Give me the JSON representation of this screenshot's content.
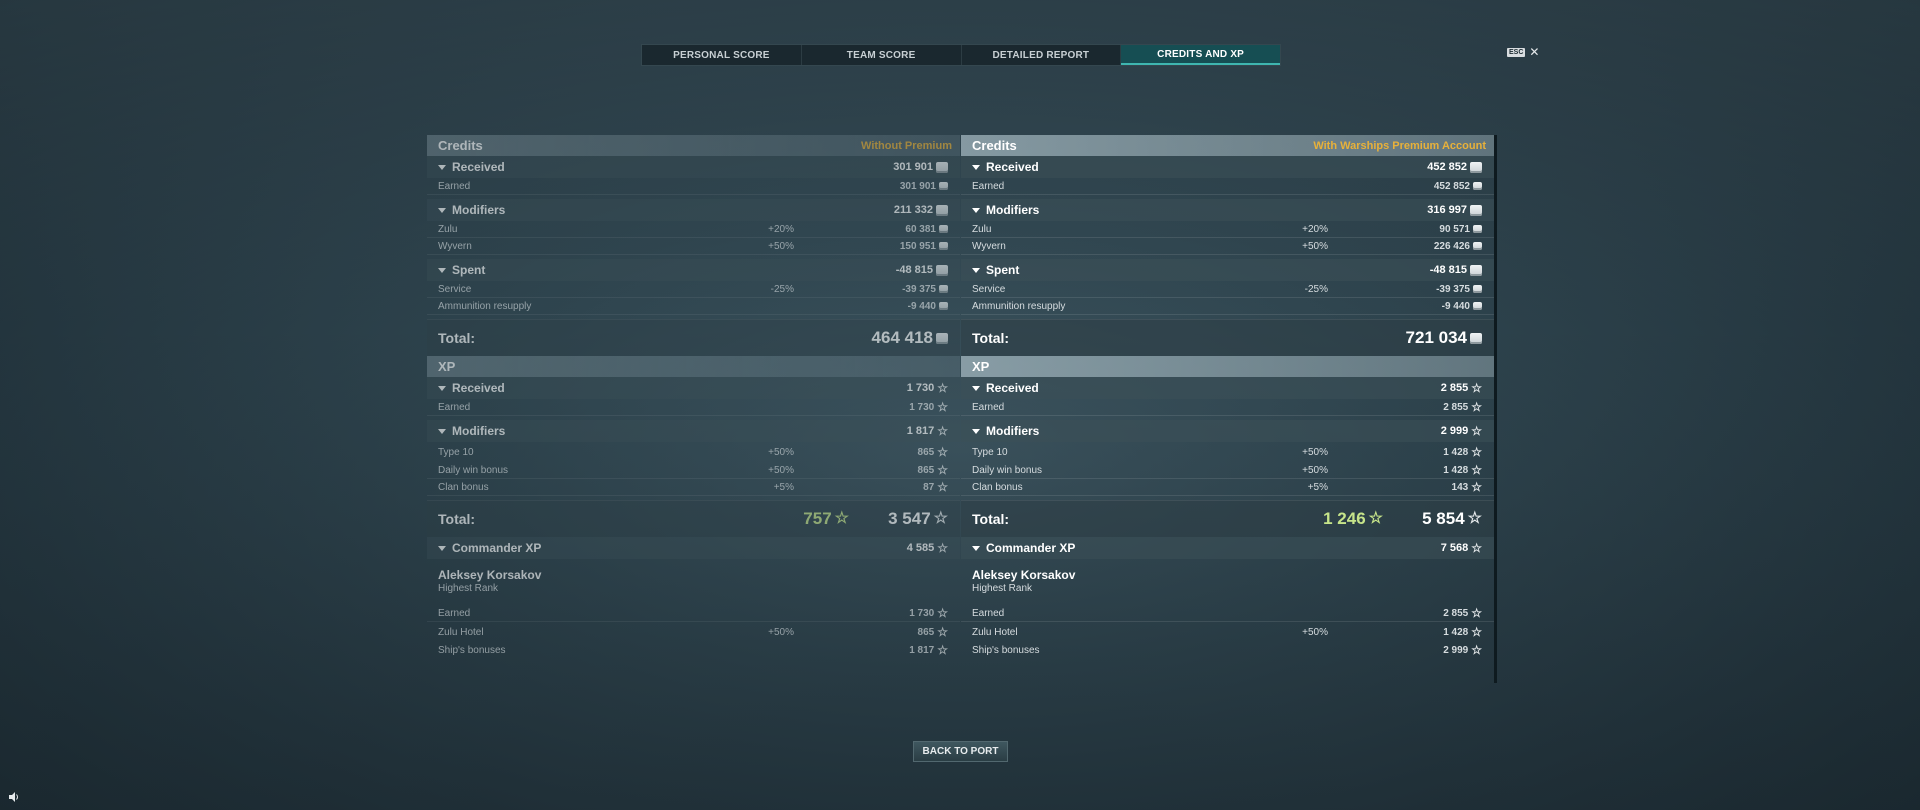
{
  "tabs": [
    "PERSONAL SCORE",
    "TEAM SCORE",
    "DETAILED REPORT",
    "CREDITS AND XP"
  ],
  "esc": {
    "key": "ESC",
    "close": "✕"
  },
  "left": {
    "credits_title": "Credits",
    "credits_sub": "Without Premium",
    "received": {
      "label": "Received",
      "value": "301 901"
    },
    "earned": {
      "label": "Earned",
      "value": "301 901"
    },
    "modifiers": {
      "label": "Modifiers",
      "value": "211 332"
    },
    "zulu": {
      "label": "Zulu",
      "pct": "+20%",
      "value": "60 381"
    },
    "wyvern": {
      "label": "Wyvern",
      "pct": "+50%",
      "value": "150 951"
    },
    "spent": {
      "label": "Spent",
      "value": "-48 815"
    },
    "service": {
      "label": "Service",
      "pct": "-25%",
      "value": "-39 375"
    },
    "ammo": {
      "label": "Ammunition resupply",
      "value": "-9 440"
    },
    "credits_total": {
      "label": "Total:",
      "value": "464 418"
    },
    "xp_title": "XP",
    "xp_received": {
      "label": "Received",
      "value": "1 730"
    },
    "xp_earned": {
      "label": "Earned",
      "value": "1 730"
    },
    "xp_modifiers": {
      "label": "Modifiers",
      "value": "1 817"
    },
    "type10": {
      "label": "Type 10",
      "pct": "+50%",
      "value": "865"
    },
    "daily": {
      "label": "Daily win bonus",
      "pct": "+50%",
      "value": "865"
    },
    "clan": {
      "label": "Clan bonus",
      "pct": "+5%",
      "value": "87"
    },
    "xp_total": {
      "label": "Total:",
      "green": "757",
      "value": "3 547"
    },
    "cmdr_xp": {
      "label": "Commander XP",
      "value": "4 585"
    },
    "cmdr_name": "Aleksey Korsakov",
    "cmdr_rank": "Highest Rank",
    "cmdr_earned": {
      "label": "Earned",
      "value": "1 730"
    },
    "zulu_hotel": {
      "label": "Zulu Hotel",
      "pct": "+50%",
      "value": "865"
    },
    "ship_bonus": {
      "label": "Ship's bonuses",
      "value": "1 817"
    }
  },
  "right": {
    "credits_title": "Credits",
    "credits_sub": "With Warships Premium Account",
    "received": {
      "label": "Received",
      "value": "452 852"
    },
    "earned": {
      "label": "Earned",
      "value": "452 852"
    },
    "modifiers": {
      "label": "Modifiers",
      "value": "316 997"
    },
    "zulu": {
      "label": "Zulu",
      "pct": "+20%",
      "value": "90 571"
    },
    "wyvern": {
      "label": "Wyvern",
      "pct": "+50%",
      "value": "226 426"
    },
    "spent": {
      "label": "Spent",
      "value": "-48 815"
    },
    "service": {
      "label": "Service",
      "pct": "-25%",
      "value": "-39 375"
    },
    "ammo": {
      "label": "Ammunition resupply",
      "value": "-9 440"
    },
    "credits_total": {
      "label": "Total:",
      "value": "721 034"
    },
    "xp_title": "XP",
    "xp_received": {
      "label": "Received",
      "value": "2 855"
    },
    "xp_earned": {
      "label": "Earned",
      "value": "2 855"
    },
    "xp_modifiers": {
      "label": "Modifiers",
      "value": "2 999"
    },
    "type10": {
      "label": "Type 10",
      "pct": "+50%",
      "value": "1 428"
    },
    "daily": {
      "label": "Daily win bonus",
      "pct": "+50%",
      "value": "1 428"
    },
    "clan": {
      "label": "Clan bonus",
      "pct": "+5%",
      "value": "143"
    },
    "xp_total": {
      "label": "Total:",
      "green": "1 246",
      "value": "5 854"
    },
    "cmdr_xp": {
      "label": "Commander XP",
      "value": "7 568"
    },
    "cmdr_name": "Aleksey Korsakov",
    "cmdr_rank": "Highest Rank",
    "cmdr_earned": {
      "label": "Earned",
      "value": "2 855"
    },
    "zulu_hotel": {
      "label": "Zulu Hotel",
      "pct": "+50%",
      "value": "1 428"
    },
    "ship_bonus": {
      "label": "Ship's bonuses",
      "value": "2 999"
    }
  },
  "back_button": "BACK TO PORT",
  "icons": {
    "credits": "credits-coin-icon",
    "xp": "xp-star-icon",
    "sound": "speaker-icon"
  },
  "colors": {
    "premium_gold": "#e8b13a",
    "xp_green": "#c7e58a",
    "active_tab": "#164e53"
  }
}
